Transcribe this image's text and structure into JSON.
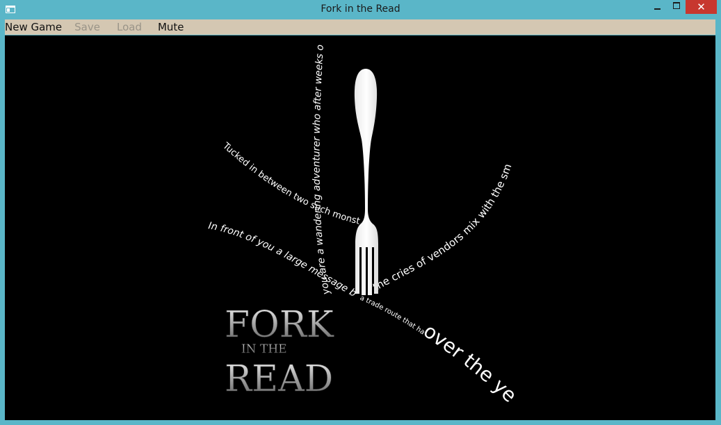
{
  "window": {
    "title": "Fork in the Read",
    "minimize_glyph": "",
    "maximize_glyph": "",
    "close_glyph": "✕"
  },
  "menu": {
    "new_game": "New Game",
    "save": "Save",
    "load": "Load",
    "mute": "Mute"
  },
  "scene": {
    "strands": {
      "top": "you are a wandering adventurer who after weeks of traveling",
      "upper_left": "Tucked in between two such monstrosities, a small",
      "left": "In front of you a large message board catches your eye",
      "right": "the cries of vendors mix with the smells of",
      "bottom_right_small": "a trade route that has been made",
      "bottom_right_large": "over the years"
    },
    "logo": {
      "line1": "FORK",
      "line2": "IN THE",
      "line3": "READ"
    },
    "colors": {
      "background": "#000000",
      "fork": "#ffffff",
      "text": "#ffffff"
    },
    "icons": [
      "fork-icon"
    ]
  }
}
